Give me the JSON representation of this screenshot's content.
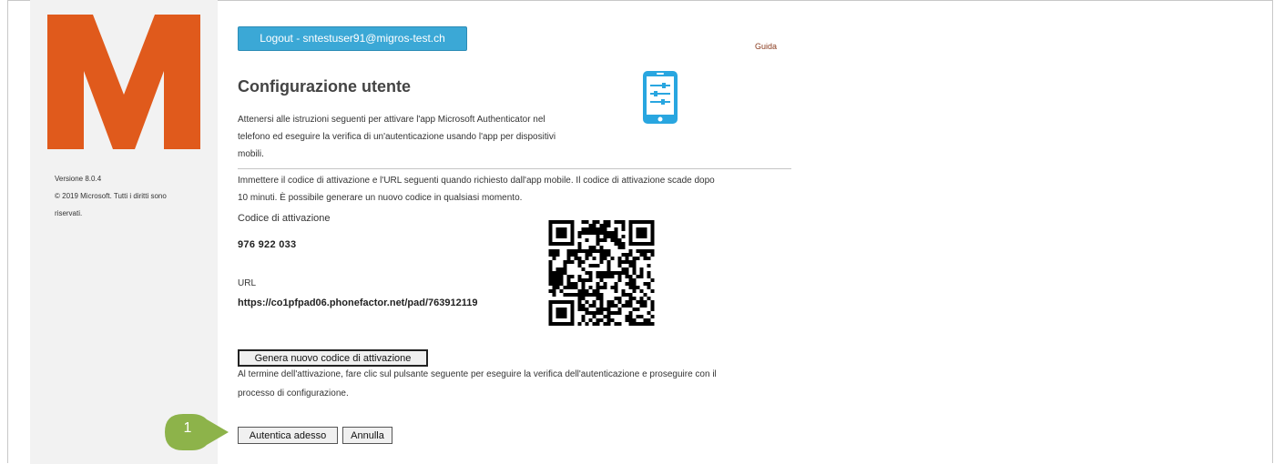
{
  "header": {
    "logout_label": "Logout - sntestuser91@migros-test.ch",
    "help_link": "Guida"
  },
  "sidebar": {
    "logo_letter": "M",
    "version": "Versione 8.0.4",
    "copyright_line1": "© 2019 Microsoft. Tutti i diritti sono",
    "copyright_line2": "riservati."
  },
  "main": {
    "title": "Configurazione utente",
    "intro_line1": "Attenersi alle istruzioni seguenti per attivare l'app Microsoft Authenticator nel",
    "intro_line2": "telefono ed eseguire la verifica di un'autenticazione usando l'app per dispositivi",
    "intro_line3": "mobili.",
    "instructions_line1": "Immettere il codice di attivazione e l'URL seguenti quando richiesto dall'app mobile. Il codice di attivazione scade dopo",
    "instructions_line2": "10 minuti. È possibile generare un nuovo codice in qualsiasi momento.",
    "activation_code_label": "Codice di attivazione",
    "activation_code": "976 922 033",
    "url_label": "URL",
    "url": "https://co1pfpad06.phonefactor.net/pad/763912119",
    "generate_button": "Genera nuovo codice di attivazione",
    "after_line1": "Al termine dell'attivazione, fare clic sul pulsante seguente per eseguire la verifica dell'autenticazione e proseguire con il",
    "after_line2": "processo di configurazione.",
    "authenticate_button": "Autentica adesso",
    "cancel_button": "Annulla"
  },
  "annotation": {
    "step_number": "1",
    "color": "#8db34a"
  },
  "colors": {
    "logo": "#e05a1c",
    "logout_button": "#3ba8d6",
    "phone_icon": "#29a6e0",
    "sidebar": "#f2f2f2"
  },
  "icons": {
    "phone": "mobile-settings-icon",
    "qr": "qr-code"
  }
}
